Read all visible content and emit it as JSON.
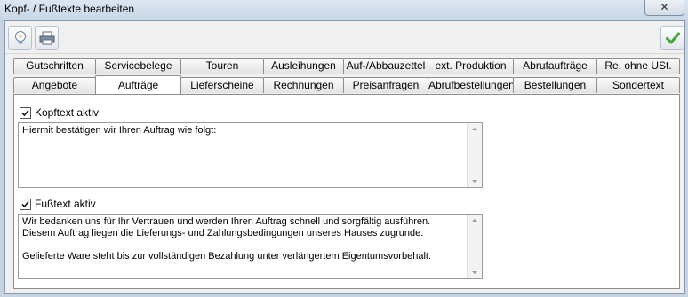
{
  "window": {
    "title": "Kopf- / Fußtexte bearbeiten",
    "close_label": "✕"
  },
  "toolbar": {
    "help_icon": "lightbulb-icon",
    "print_icon": "printer-icon",
    "ok_icon": "green-check-icon"
  },
  "tabs": {
    "row_top": [
      "Gutschriften",
      "Servicebelege",
      "Touren",
      "Ausleihungen",
      "Auf-/Abbauzettel",
      "ext. Produktion",
      "Abrufaufträge",
      "Re. ohne USt."
    ],
    "row_bottom": [
      "Angebote",
      "Aufträge",
      "Lieferscheine",
      "Rechnungen",
      "Preisanfragen",
      "Abrufbestellungen",
      "Bestellungen",
      "Sondertext"
    ],
    "active": "Aufträge"
  },
  "kopftext": {
    "label": "Kopftext aktiv",
    "checked": true,
    "text": "Hiermit bestätigen wir Ihren Auftrag wie folgt:"
  },
  "fusstext": {
    "label": "Fußtext aktiv",
    "checked": true,
    "text": "Wir bedanken uns für Ihr Vertrauen und werden Ihren Auftrag schnell und sorgfältig ausführen.\nDiesem Auftrag liegen die Lieferungs- und Zahlungsbedingungen unseres Hauses zugrunde.\n\nGelieferte Ware steht bis zur vollständigen Bezahlung unter verlängertem Eigentumsvorbehalt."
  },
  "colors": {
    "accent_check": "#3fa535",
    "frame": "#c7d3e0"
  }
}
